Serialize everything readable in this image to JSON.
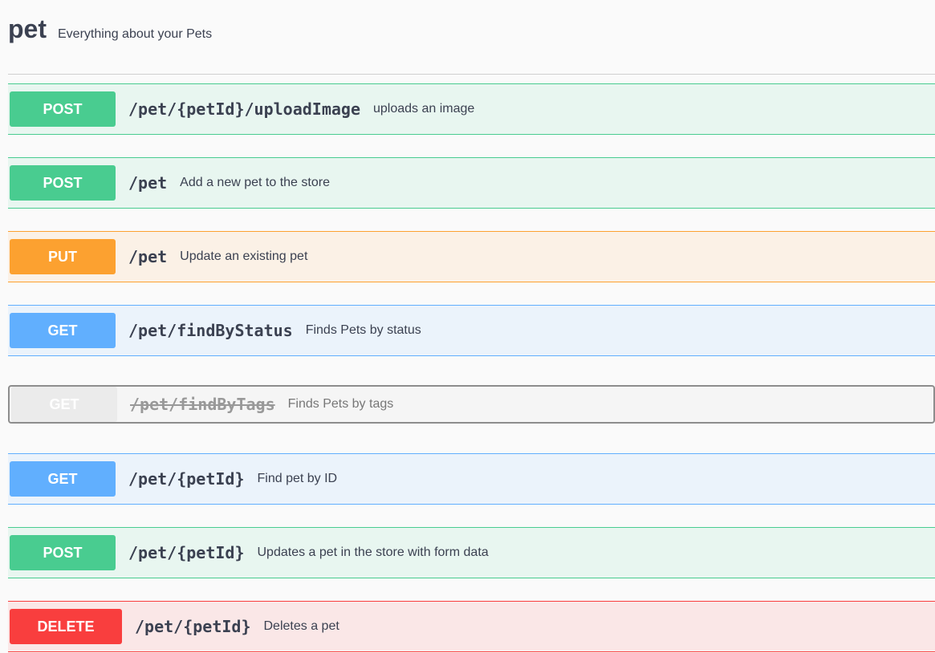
{
  "tag": {
    "name": "pet",
    "description": "Everything about your Pets"
  },
  "operations": [
    {
      "method": "POST",
      "path": "/pet/{petId}/uploadImage",
      "summary": "uploads an image",
      "type": "post",
      "deprecated": false
    },
    {
      "method": "POST",
      "path": "/pet",
      "summary": "Add a new pet to the store",
      "type": "post",
      "deprecated": false
    },
    {
      "method": "PUT",
      "path": "/pet",
      "summary": "Update an existing pet",
      "type": "put",
      "deprecated": false
    },
    {
      "method": "GET",
      "path": "/pet/findByStatus",
      "summary": "Finds Pets by status",
      "type": "get",
      "deprecated": false
    },
    {
      "method": "GET",
      "path": "/pet/findByTags",
      "summary": "Finds Pets by tags",
      "type": "get",
      "deprecated": true
    },
    {
      "method": "GET",
      "path": "/pet/{petId}",
      "summary": "Find pet by ID",
      "type": "get",
      "deprecated": false
    },
    {
      "method": "POST",
      "path": "/pet/{petId}",
      "summary": "Updates a pet in the store with form data",
      "type": "post",
      "deprecated": false
    },
    {
      "method": "DELETE",
      "path": "/pet/{petId}",
      "summary": "Deletes a pet",
      "type": "delete",
      "deprecated": false
    }
  ],
  "colors": {
    "post": "#49cc90",
    "put": "#fca130",
    "get": "#61affe",
    "delete": "#f93e3e",
    "deprecated": "#ebebeb",
    "text": "#3b4151"
  }
}
